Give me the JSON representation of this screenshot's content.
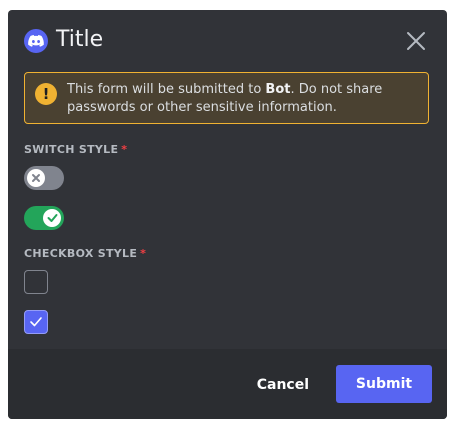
{
  "modal": {
    "title": "Title",
    "app_icon": "discord-icon",
    "close_icon": "close-icon"
  },
  "warning": {
    "icon": "warning-icon",
    "icon_glyph": "!",
    "text_before": "This form will be submitted to ",
    "bot_name": "Bot",
    "text_after": ". Do not share passwords or other sensitive information."
  },
  "fields": [
    {
      "label": "SWITCH STYLE",
      "required_mark": "*",
      "options": [
        {
          "type": "switch",
          "checked": false
        },
        {
          "type": "switch",
          "checked": true
        }
      ]
    },
    {
      "label": "CHECKBOX STYLE",
      "required_mark": "*",
      "options": [
        {
          "type": "checkbox",
          "checked": false
        },
        {
          "type": "checkbox",
          "checked": true
        }
      ]
    }
  ],
  "footer": {
    "cancel_label": "Cancel",
    "submit_label": "Submit"
  },
  "colors": {
    "background": "#313338",
    "footer": "#2b2d31",
    "accent": "#5865f2",
    "warning": "#f0b232",
    "success": "#23a55a",
    "required": "#f23f43"
  }
}
